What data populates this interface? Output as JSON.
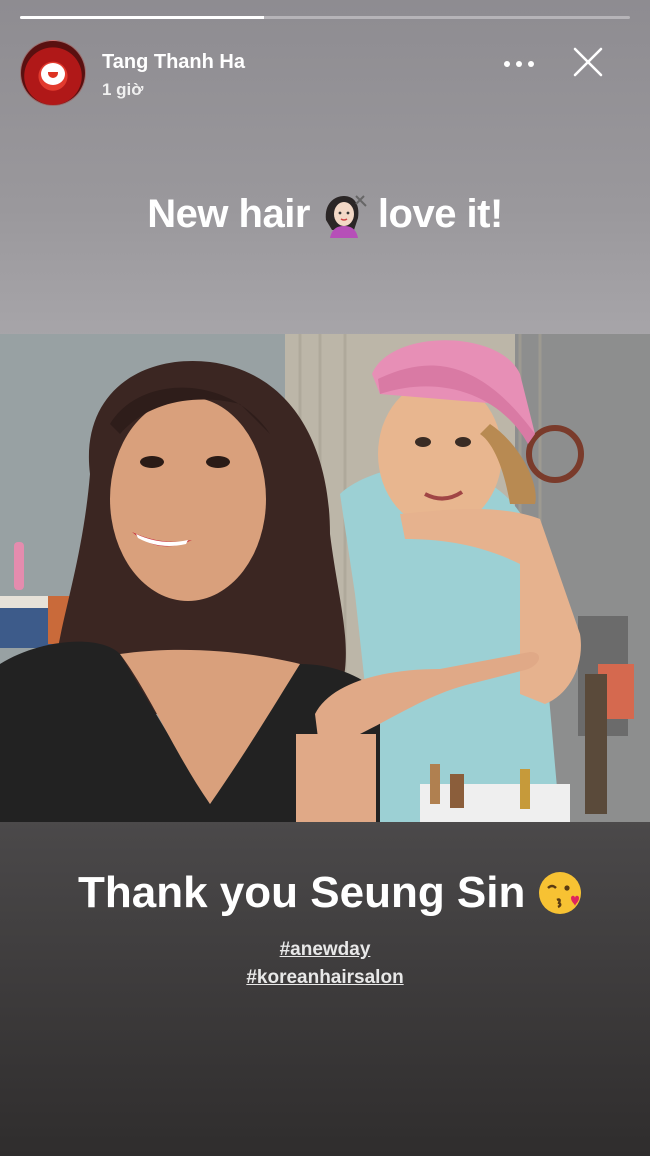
{
  "story": {
    "progress_fraction": 0.4,
    "user": {
      "name": "Tang Thanh Ha",
      "time": "1 giờ"
    },
    "caption_top": {
      "before": "New hair",
      "emoji": "woman-getting-haircut-emoji",
      "after": "love it!"
    },
    "photo": {
      "description_icon": "selfie-photo"
    },
    "caption_bottom": {
      "text": "Thank you Seung Sin",
      "emoji": "face-blowing-kiss-emoji"
    },
    "hashtags": [
      "#anewday",
      "#koreanhairsalon"
    ],
    "icons": {
      "more": "more-dots-icon",
      "close": "close-icon"
    }
  },
  "colors": {
    "accent": "#ffffff",
    "lip_red": "#c8283a",
    "cap_pink": "#e89bbc"
  }
}
